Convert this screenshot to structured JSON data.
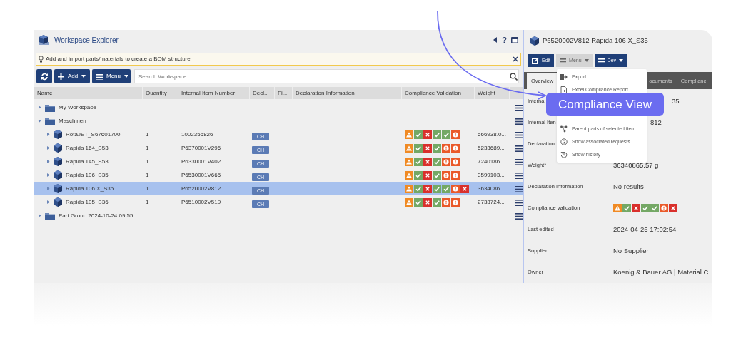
{
  "explorer": {
    "title": "Workspace Explorer",
    "help": "?",
    "hint": "Add and import parts/materials to create a BOM structure",
    "toolbar": {
      "add": "Add",
      "menu": "Menu",
      "search_placeholder": "Search Workspace"
    },
    "columns": [
      "Name",
      "Quantity",
      "Internal Item Number",
      "Decl...",
      "Fi...",
      "Declaration Information",
      "Compliance Validation",
      "Weight"
    ],
    "rows": [
      {
        "kind": "folder",
        "name": "My Workspace",
        "expanded": false,
        "selected": false
      },
      {
        "kind": "folder",
        "name": "Maschinen",
        "expanded": true,
        "selected": false,
        "children": [
          {
            "kind": "part",
            "name": "RotaJET_S67601700",
            "expanded": false,
            "selected": false,
            "quantity": "1",
            "item_number": "1002355826",
            "decl": "CH",
            "validation": [
              {
                "kind": "warn"
              },
              {
                "kind": "ok"
              },
              {
                "kind": "fail"
              },
              {
                "kind": "ok"
              },
              {
                "kind": "ok"
              },
              {
                "kind": "alert"
              }
            ],
            "weight": "566938.0..."
          },
          {
            "kind": "part",
            "name": "Rapida 164_S53",
            "expanded": false,
            "selected": false,
            "quantity": "1",
            "item_number": "P6370001V296",
            "decl": "CH",
            "validation": [
              {
                "kind": "warn"
              },
              {
                "kind": "ok"
              },
              {
                "kind": "fail"
              },
              {
                "kind": "ok"
              },
              {
                "kind": "alert"
              },
              {
                "kind": "alert"
              }
            ],
            "weight": "5233689..."
          },
          {
            "kind": "part",
            "name": "Rapida 145_S53",
            "expanded": false,
            "selected": false,
            "quantity": "1",
            "item_number": "P6330001V402",
            "decl": "CH",
            "validation": [
              {
                "kind": "warn"
              },
              {
                "kind": "ok"
              },
              {
                "kind": "fail"
              },
              {
                "kind": "ok"
              },
              {
                "kind": "alert"
              },
              {
                "kind": "alert"
              }
            ],
            "weight": "7240186..."
          },
          {
            "kind": "part",
            "name": "Rapida 106_S35",
            "expanded": false,
            "selected": false,
            "quantity": "1",
            "item_number": "P6530001V665",
            "decl": "CH",
            "validation": [
              {
                "kind": "warn"
              },
              {
                "kind": "ok"
              },
              {
                "kind": "fail"
              },
              {
                "kind": "ok"
              },
              {
                "kind": "alert"
              },
              {
                "kind": "alert"
              }
            ],
            "weight": "3599103..."
          },
          {
            "kind": "part",
            "name": "Rapida 106 X_S35",
            "expanded": false,
            "selected": true,
            "quantity": "1",
            "item_number": "P6520002V812",
            "decl": "CH",
            "validation": [
              {
                "kind": "warn"
              },
              {
                "kind": "ok"
              },
              {
                "kind": "fail"
              },
              {
                "kind": "ok"
              },
              {
                "kind": "ok"
              },
              {
                "kind": "alert"
              },
              {
                "kind": "fail"
              }
            ],
            "weight": "3634086..."
          },
          {
            "kind": "part",
            "name": "Rapida 105_S36",
            "expanded": false,
            "selected": false,
            "quantity": "1",
            "item_number": "P6510002V519",
            "decl": "CH",
            "validation": [
              {
                "kind": "warn"
              },
              {
                "kind": "ok"
              },
              {
                "kind": "fail"
              },
              {
                "kind": "ok"
              },
              {
                "kind": "alert"
              },
              {
                "kind": "alert"
              }
            ],
            "weight": "2733724..."
          }
        ]
      },
      {
        "kind": "folder",
        "name": "Part Group 2024-10-24 09:55:...",
        "expanded": false,
        "selected": false
      }
    ]
  },
  "detail": {
    "title": "P6520002V812 Rapida 106 X_S35",
    "buttons": [
      {
        "label": "Edit",
        "open": false
      },
      {
        "label": "Menu",
        "open": true
      },
      {
        "label": "Dev",
        "open": false
      }
    ],
    "tabs": [
      {
        "label": "Overview",
        "selected": true
      },
      {
        "label": "ocuments",
        "selected": false
      },
      {
        "label": "Complianc",
        "selected": false
      }
    ],
    "menu_items": [
      "Export",
      "Excel Compliance Report",
      "Parent parts of selected item",
      "Show associated requests",
      "Show history"
    ],
    "fields": [
      {
        "kind": "covered",
        "label": "Interna",
        "value": "35"
      },
      {
        "kind": "covered",
        "label": "Internal Iten",
        "value": "812"
      },
      {
        "kind": "text",
        "label": "Declaration"
      },
      {
        "kind": "text",
        "label": "Weight*",
        "value": "36340865.57 g"
      },
      {
        "kind": "text",
        "label": "Declaration Information",
        "value": "No results"
      },
      {
        "kind": "validation",
        "label": "Compliance validation",
        "validation": [
          {
            "kind": "warn"
          },
          {
            "kind": "ok"
          },
          {
            "kind": "fail"
          },
          {
            "kind": "ok"
          },
          {
            "kind": "ok"
          },
          {
            "kind": "alert"
          },
          {
            "kind": "fail"
          }
        ]
      },
      {
        "kind": "text",
        "label": "Last edited",
        "value": "2024-04-25 17:02:54"
      },
      {
        "kind": "text",
        "label": "Supplier",
        "value": "No Supplier"
      },
      {
        "kind": "text",
        "label": "Owner",
        "value": "Koenig & Bauer AG | Material C"
      }
    ]
  },
  "callout": "Compliance View"
}
